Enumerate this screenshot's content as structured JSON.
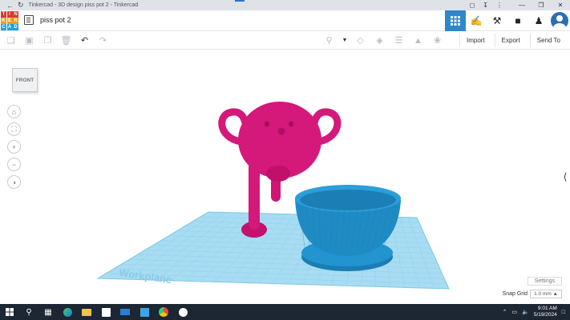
{
  "browser": {
    "tab_title": "Tinkercad - 3D design piss pot 2 - Tinkercad",
    "back_icon": "back-arrow-icon",
    "reload_icon": "reload-icon",
    "controls": [
      "share-icon",
      "download-icon",
      "more-icon"
    ],
    "window_controls": [
      "minimize-icon",
      "maximize-icon",
      "close-icon"
    ]
  },
  "app": {
    "logo_letters": [
      "T",
      "I",
      "N",
      "K",
      "E",
      "R",
      "C",
      "A",
      "D"
    ],
    "logo_colors": [
      "#e3342f",
      "#e3342f",
      "#e3342f",
      "#f39c12",
      "#f39c12",
      "#f39c12",
      "#1fa0d8",
      "#1fa0d8",
      "#1fa0d8"
    ],
    "design_title": "piss pot 2",
    "header_buttons": [
      "grid-view-icon",
      "brush-icon",
      "pickaxe-icon",
      "bricks-icon",
      "add-user-icon"
    ]
  },
  "toolbar": {
    "import_label": "Import",
    "export_label": "Export",
    "send_to_label": "Send To"
  },
  "viewport": {
    "viewcube_label": "FRONT",
    "workplane_label": "Workplane",
    "settings_label": "Settings",
    "snap_grid_label": "Snap Grid",
    "snap_grid_value": "1.0 mm",
    "colors": {
      "pink_shape": "#d4197a",
      "blue_shape": "#1f8bc4",
      "workplane": "#a8dcf2",
      "accent": "#2d88ca"
    }
  },
  "taskbar": {
    "time": "9:01 AM",
    "date": "5/19/2024"
  }
}
